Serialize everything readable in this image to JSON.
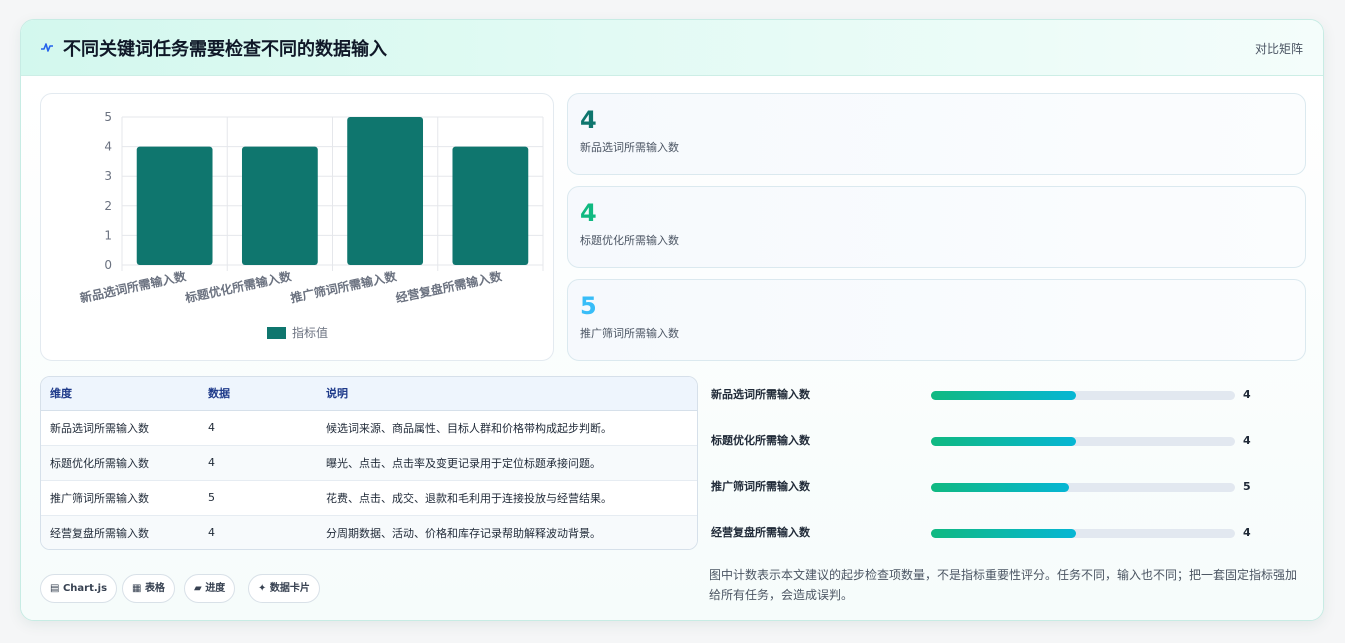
{
  "header": {
    "title": "不同关键词任务需要检查不同的数据输入",
    "link": "对比矩阵",
    "icon": "pulse-icon"
  },
  "chart_data": {
    "type": "bar",
    "categories": [
      "新品选词所需输入数",
      "标题优化所需输入数",
      "推广筛词所需输入数",
      "经营复盘所需输入数"
    ],
    "series": [
      {
        "name": "指标值",
        "values": [
          4,
          4,
          5,
          4
        ]
      }
    ],
    "ylim": [
      0,
      5
    ],
    "yticks": [
      0,
      1,
      2,
      3,
      4,
      5
    ],
    "color": "#0f766e",
    "legend": "bottom",
    "grid": true
  },
  "stats": [
    {
      "value": "4",
      "label": "新品选词所需输入数",
      "color": "#0f766e"
    },
    {
      "value": "4",
      "label": "标题优化所需输入数",
      "color": "#10b981"
    },
    {
      "value": "5",
      "label": "推广筛词所需输入数",
      "color": "#38bdf8"
    }
  ],
  "table": {
    "headers": [
      "维度",
      "数据",
      "说明"
    ],
    "rows": [
      [
        "新品选词所需输入数",
        "4",
        "候选词来源、商品属性、目标人群和价格带构成起步判断。"
      ],
      [
        "标题优化所需输入数",
        "4",
        "曝光、点击、点击率及变更记录用于定位标题承接问题。"
      ],
      [
        "推广筛词所需输入数",
        "5",
        "花费、点击、成交、退款和毛利用于连接投放与经营结果。"
      ],
      [
        "经营复盘所需输入数",
        "4",
        "分周期数据、活动、价格和库存记录帮助解释波动背景。"
      ]
    ]
  },
  "chips": [
    {
      "icon": "chart-icon",
      "glyph": "▤",
      "label": "Chart.js"
    },
    {
      "icon": "table-icon",
      "glyph": "▦",
      "label": "表格"
    },
    {
      "icon": "progress-icon",
      "glyph": "▰",
      "label": "进度"
    },
    {
      "icon": "card-icon",
      "glyph": "✦",
      "label": "数据卡片"
    }
  ],
  "progress": [
    {
      "label": "新品选词所需输入数",
      "value": 4,
      "max": 8.4,
      "display": "4"
    },
    {
      "label": "标题优化所需输入数",
      "value": 4,
      "max": 8.4,
      "display": "4"
    },
    {
      "label": "推广筛词所需输入数",
      "value": 5,
      "max": 11,
      "display": "5"
    },
    {
      "label": "经营复盘所需输入数",
      "value": 4,
      "max": 8.4,
      "display": "4"
    }
  ],
  "note": "图中计数表示本文建议的起步检查项数量，不是指标重要性评分。任务不同，输入也不同；把一套固定指标强加给所有任务，会造成误判。"
}
